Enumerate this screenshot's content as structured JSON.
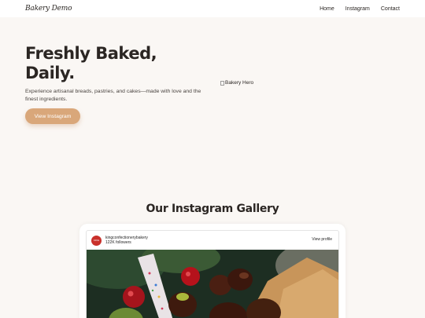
{
  "nav": {
    "logo": "Bakery Demo",
    "links": [
      "Home",
      "Instagram",
      "Contact"
    ]
  },
  "hero": {
    "title_line1": "Freshly Baked,",
    "title_line2": "Daily.",
    "subtitle": "Experience artisanal breads, pastries, and cakes—made with love and the finest ingredients.",
    "cta_label": "View Instagram",
    "image_alt": "Bakery Hero"
  },
  "gallery": {
    "title": "Our Instagram Gallery",
    "embed": {
      "account_name": "kingconfectionerybakery",
      "followers": "122K followers",
      "view_profile_label": "View profile",
      "avatar_text": "KING"
    }
  },
  "colors": {
    "background": "#faf7f4",
    "accent": "#d9a77a",
    "text": "#2b2623"
  }
}
